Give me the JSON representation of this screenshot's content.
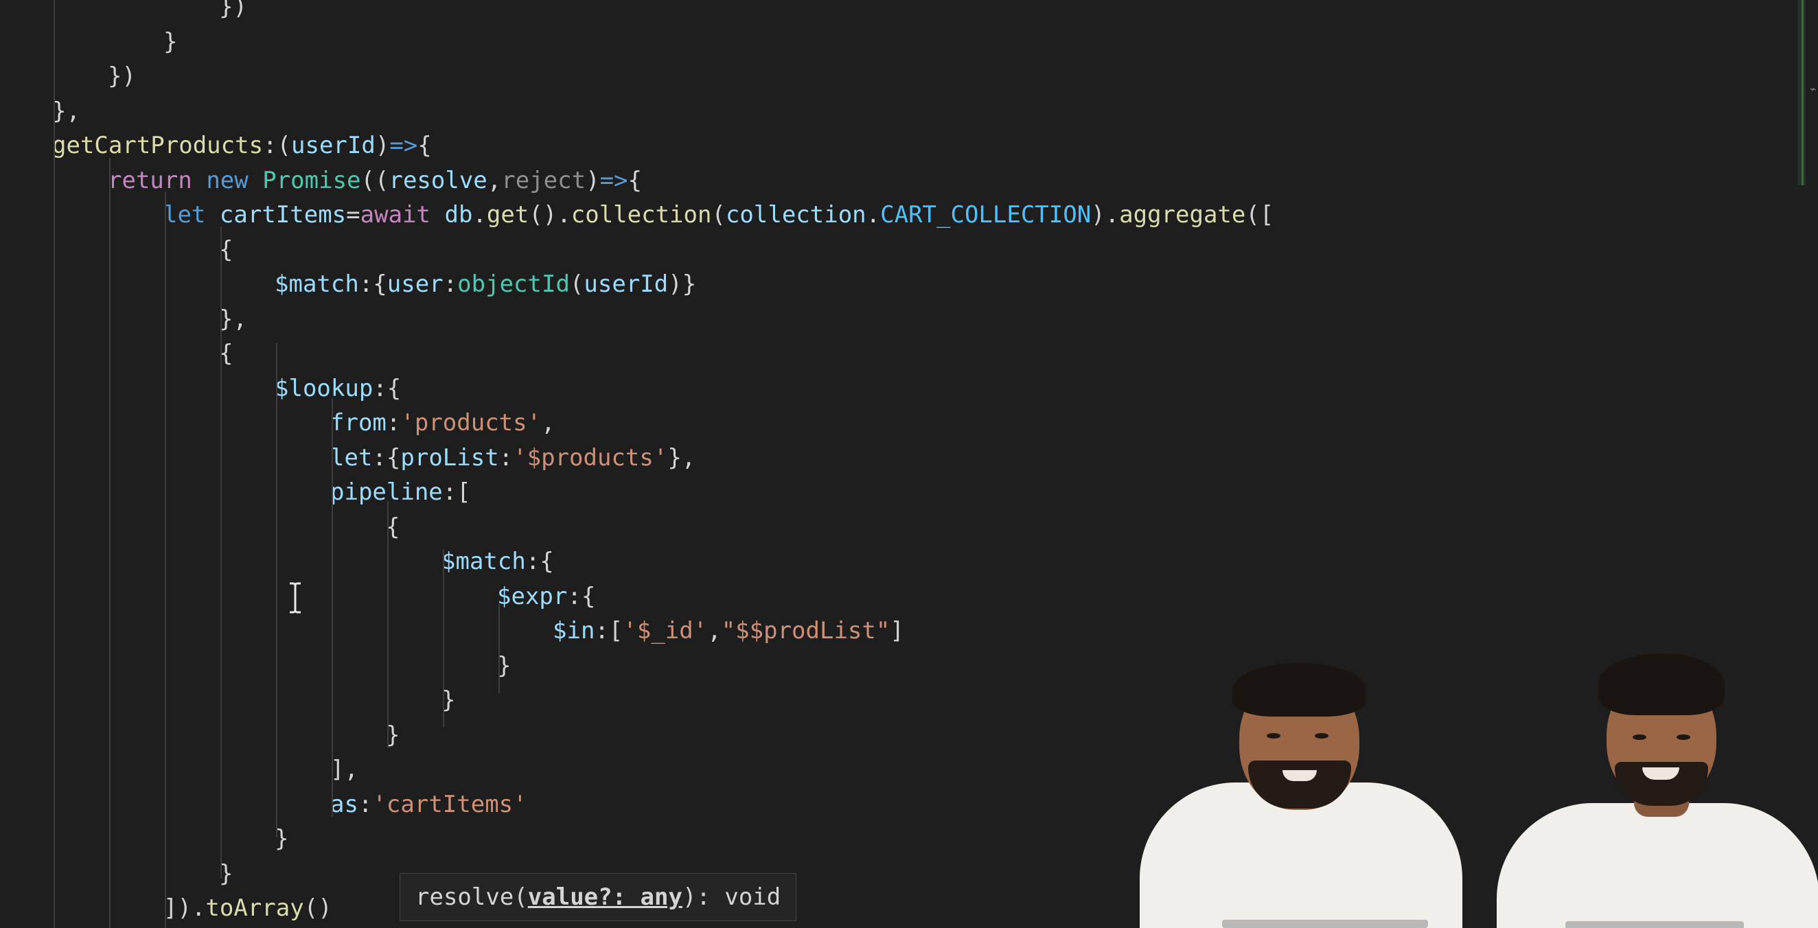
{
  "editor": {
    "language": "javascript",
    "lines": [
      {
        "tokens": [
          {
            "t": "})",
            "c": "pun"
          }
        ]
      },
      {
        "tokens": [
          {
            "t": "}",
            "c": "pun"
          }
        ]
      },
      {
        "tokens": [
          {
            "t": "})",
            "c": "pun"
          }
        ]
      },
      {
        "tokens": [
          {
            "t": "},",
            "c": "pun"
          }
        ]
      },
      {
        "tokens": [
          {
            "t": "getCartProducts",
            "c": "fn"
          },
          {
            "t": ":(",
            "c": "pun"
          },
          {
            "t": "userId",
            "c": "var"
          },
          {
            "t": ")",
            "c": "pun"
          },
          {
            "t": "=>",
            "c": "kw"
          },
          {
            "t": "{",
            "c": "pun"
          }
        ]
      },
      {
        "tokens": [
          {
            "t": "return",
            "c": "ctl"
          },
          {
            "t": " ",
            "c": "pun"
          },
          {
            "t": "new",
            "c": "kw"
          },
          {
            "t": " ",
            "c": "pun"
          },
          {
            "t": "Promise",
            "c": "cls"
          },
          {
            "t": "((",
            "c": "pun"
          },
          {
            "t": "resolve",
            "c": "var"
          },
          {
            "t": ",",
            "c": "pun"
          },
          {
            "t": "reject",
            "c": "dim"
          },
          {
            "t": ")",
            "c": "pun"
          },
          {
            "t": "=>",
            "c": "kw"
          },
          {
            "t": "{",
            "c": "pun"
          }
        ]
      },
      {
        "tokens": [
          {
            "t": "let",
            "c": "kw"
          },
          {
            "t": " ",
            "c": "pun"
          },
          {
            "t": "cartItems",
            "c": "var"
          },
          {
            "t": "=",
            "c": "pun"
          },
          {
            "t": "await",
            "c": "ctl"
          },
          {
            "t": " ",
            "c": "pun"
          },
          {
            "t": "db",
            "c": "var"
          },
          {
            "t": ".",
            "c": "pun"
          },
          {
            "t": "get",
            "c": "fn"
          },
          {
            "t": "().",
            "c": "pun"
          },
          {
            "t": "collection",
            "c": "fn"
          },
          {
            "t": "(",
            "c": "pun"
          },
          {
            "t": "collection",
            "c": "var"
          },
          {
            "t": ".",
            "c": "pun"
          },
          {
            "t": "CART_COLLECTION",
            "c": "const"
          },
          {
            "t": ").",
            "c": "pun"
          },
          {
            "t": "aggregate",
            "c": "fn"
          },
          {
            "t": "([",
            "c": "pun"
          }
        ]
      },
      {
        "tokens": [
          {
            "t": "{",
            "c": "pun"
          }
        ]
      },
      {
        "tokens": [
          {
            "t": "$match",
            "c": "prop"
          },
          {
            "t": ":{",
            "c": "pun"
          },
          {
            "t": "user",
            "c": "prop"
          },
          {
            "t": ":",
            "c": "pun"
          },
          {
            "t": "objectId",
            "c": "cls"
          },
          {
            "t": "(",
            "c": "pun"
          },
          {
            "t": "userId",
            "c": "var"
          },
          {
            "t": ")}",
            "c": "pun"
          }
        ]
      },
      {
        "tokens": [
          {
            "t": "},",
            "c": "pun"
          }
        ]
      },
      {
        "tokens": [
          {
            "t": "{",
            "c": "pun"
          }
        ]
      },
      {
        "tokens": [
          {
            "t": "$lookup",
            "c": "prop"
          },
          {
            "t": ":{",
            "c": "pun"
          }
        ]
      },
      {
        "tokens": [
          {
            "t": "from",
            "c": "prop"
          },
          {
            "t": ":",
            "c": "pun"
          },
          {
            "t": "'products'",
            "c": "str"
          },
          {
            "t": ",",
            "c": "pun"
          }
        ]
      },
      {
        "tokens": [
          {
            "t": "let",
            "c": "prop"
          },
          {
            "t": ":{",
            "c": "pun"
          },
          {
            "t": "proList",
            "c": "prop"
          },
          {
            "t": ":",
            "c": "pun"
          },
          {
            "t": "'$products'",
            "c": "str"
          },
          {
            "t": "},",
            "c": "pun"
          }
        ]
      },
      {
        "tokens": [
          {
            "t": "pipeline",
            "c": "prop"
          },
          {
            "t": ":[",
            "c": "pun"
          }
        ]
      },
      {
        "tokens": [
          {
            "t": "{",
            "c": "pun"
          }
        ]
      },
      {
        "tokens": [
          {
            "t": "$match",
            "c": "prop"
          },
          {
            "t": ":{",
            "c": "pun"
          }
        ]
      },
      {
        "tokens": [
          {
            "t": "$expr",
            "c": "prop"
          },
          {
            "t": ":{",
            "c": "pun"
          }
        ]
      },
      {
        "tokens": [
          {
            "t": "$in",
            "c": "prop"
          },
          {
            "t": ":[",
            "c": "pun"
          },
          {
            "t": "'$_id'",
            "c": "str"
          },
          {
            "t": ",",
            "c": "pun"
          },
          {
            "t": "\"$$prodList\"",
            "c": "str"
          },
          {
            "t": "]",
            "c": "pun"
          }
        ]
      },
      {
        "tokens": [
          {
            "t": "}",
            "c": "pun"
          }
        ]
      },
      {
        "tokens": [
          {
            "t": "}",
            "c": "pun"
          }
        ]
      },
      {
        "tokens": [
          {
            "t": "}",
            "c": "pun"
          }
        ]
      },
      {
        "tokens": [
          {
            "t": "],",
            "c": "pun"
          }
        ]
      },
      {
        "tokens": [
          {
            "t": "as",
            "c": "prop"
          },
          {
            "t": ":",
            "c": "pun"
          },
          {
            "t": "'cartItems'",
            "c": "str"
          }
        ]
      },
      {
        "tokens": [
          {
            "t": "}",
            "c": "pun"
          }
        ]
      },
      {
        "tokens": [
          {
            "t": "}",
            "c": "pun"
          }
        ]
      },
      {
        "tokens": [
          {
            "t": "]).",
            "c": "pun"
          },
          {
            "t": "toArray",
            "c": "fn"
          },
          {
            "t": "()",
            "c": "pun"
          }
        ]
      }
    ]
  },
  "tooltip": {
    "fn_name": "resolve",
    "open_paren": "(",
    "param": "value?: any",
    "suffix": "): void"
  },
  "colors": {
    "background": "#1e1e1e",
    "keyword": "#569cd6",
    "control": "#c586c0",
    "function": "#dcdcaa",
    "property": "#9cdcfe",
    "class": "#4ec9b0",
    "string": "#ce9178",
    "constant": "#4fc1ff"
  },
  "icons": {
    "text_cursor": "i-beam-cursor-icon"
  }
}
